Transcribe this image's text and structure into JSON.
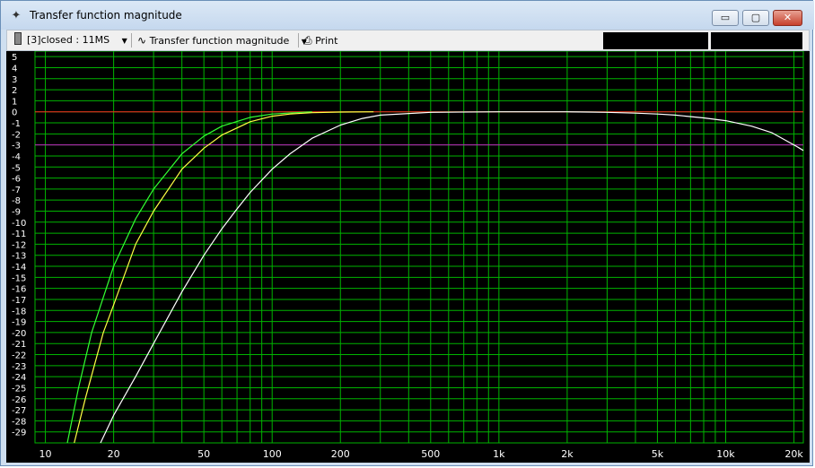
{
  "window": {
    "title": "Transfer function magnitude",
    "icon": "crosshair-icon"
  },
  "window_controls": {
    "minimize": "▭",
    "maximize": "▢",
    "close": "✕"
  },
  "toolbar": {
    "measurement_selector": "[3]closed : 11MS",
    "view_selector": "Transfer function magnitude",
    "print_label": "Print"
  },
  "colors": {
    "background": "#000000",
    "grid": "#00b400",
    "reference_line": "#ff2020",
    "marker_line": "#c020c0",
    "axis_text": "#ffffff",
    "curve_green": "#33ff33",
    "curve_yellow": "#ffff44",
    "curve_white": "#ffffff"
  },
  "chart_data": {
    "type": "line",
    "xscale": "log",
    "xlim": [
      9,
      22000
    ],
    "ylim": [
      -30,
      5.5
    ],
    "grid": true,
    "x_tick_labels": [
      {
        "v": 10,
        "t": "10"
      },
      {
        "v": 20,
        "t": "20"
      },
      {
        "v": 50,
        "t": "50"
      },
      {
        "v": 100,
        "t": "100"
      },
      {
        "v": 200,
        "t": "200"
      },
      {
        "v": 500,
        "t": "500"
      },
      {
        "v": 1000,
        "t": "1k"
      },
      {
        "v": 2000,
        "t": "2k"
      },
      {
        "v": 5000,
        "t": "5k"
      },
      {
        "v": 10000,
        "t": "10k"
      },
      {
        "v": 20000,
        "t": "20k"
      }
    ],
    "y_ticks": [
      5,
      4,
      3,
      2,
      1,
      0,
      -1,
      -2,
      -3,
      -4,
      -5,
      -6,
      -7,
      -8,
      -9,
      -10,
      -11,
      -12,
      -13,
      -14,
      -15,
      -16,
      -17,
      -18,
      -19,
      -20,
      -21,
      -22,
      -23,
      -24,
      -25,
      -26,
      -27,
      -28,
      -29
    ],
    "reference_lines": [
      {
        "y": 0,
        "color": "#ff2020"
      },
      {
        "y": -3,
        "color": "#c020c0"
      }
    ],
    "series": [
      {
        "color": "#33ff33",
        "x": [
          12.5,
          14,
          16,
          20,
          25,
          30,
          40,
          50,
          60,
          80,
          100,
          150
        ],
        "y": [
          -30,
          -25,
          -20,
          -14,
          -9.7,
          -7,
          -3.8,
          -2.2,
          -1.3,
          -0.5,
          -0.2,
          0
        ]
      },
      {
        "color": "#ffff44",
        "x": [
          13.4,
          15,
          18,
          20,
          25,
          30,
          40,
          50,
          60,
          80,
          100,
          120,
          150,
          200,
          280
        ],
        "y": [
          -30,
          -26,
          -20,
          -17.5,
          -12,
          -9,
          -5.2,
          -3.3,
          -2.1,
          -0.9,
          -0.4,
          -0.2,
          -0.08,
          -0.02,
          0
        ]
      },
      {
        "color": "#ffffff",
        "x": [
          17.5,
          20,
          25,
          30,
          40,
          50,
          60,
          70,
          80,
          100,
          120,
          150,
          200,
          250,
          300,
          500,
          1000,
          2000,
          2500,
          3000,
          4000,
          5000,
          6000,
          8000,
          10000,
          13000,
          16000,
          20000,
          22000
        ],
        "y": [
          -30,
          -27.5,
          -24,
          -21,
          -16.3,
          -13,
          -10.6,
          -8.8,
          -7.3,
          -5.2,
          -3.8,
          -2.4,
          -1.2,
          -0.6,
          -0.3,
          -0.05,
          0,
          0,
          -0.02,
          -0.05,
          -0.12,
          -0.2,
          -0.3,
          -0.55,
          -0.8,
          -1.3,
          -1.9,
          -3,
          -3.5
        ]
      }
    ]
  }
}
